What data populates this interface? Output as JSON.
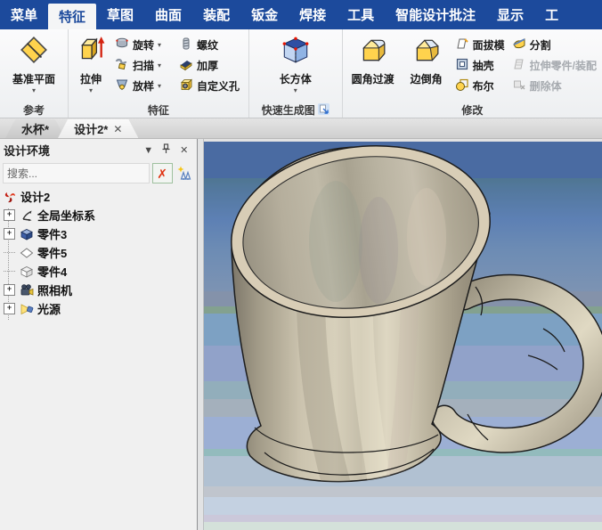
{
  "colors": {
    "menubar_blue": "#1c4a9c",
    "mug_body_tan": "#c5beaa",
    "viewport_sky_top": "#4a6ba2",
    "viewport_sky_bottom": "#d4e1da"
  },
  "menu": {
    "items": [
      {
        "label": "菜单",
        "active": false
      },
      {
        "label": "特征",
        "active": true
      },
      {
        "label": "草图",
        "active": false
      },
      {
        "label": "曲面",
        "active": false
      },
      {
        "label": "装配",
        "active": false
      },
      {
        "label": "钣金",
        "active": false
      },
      {
        "label": "焊接",
        "active": false
      },
      {
        "label": "工具",
        "active": false
      },
      {
        "label": "智能设计批注",
        "active": false
      },
      {
        "label": "显示",
        "active": false
      },
      {
        "label": "工",
        "active": false
      }
    ]
  },
  "ribbon": {
    "groups": [
      {
        "label": "参考"
      },
      {
        "label": "特征"
      },
      {
        "label": "快速生成图"
      },
      {
        "label": "修改"
      }
    ],
    "buttons": {
      "datum_plane": "基准平面",
      "extrude": "拉伸",
      "revolve": "旋转",
      "sweep": "扫描",
      "loft": "放样",
      "thread": "螺纹",
      "thicken": "加厚",
      "custom_hole": "自定义孔",
      "box": "长方体",
      "fillet": "圆角过渡",
      "chamfer": "边倒角",
      "face_draft": "面拔模",
      "shell": "抽壳",
      "boolean": "布尔",
      "split": "分割",
      "stretch_part": "拉伸零件/装配",
      "delete_body": "删除体"
    }
  },
  "document_tabs": [
    {
      "label": "水杯*",
      "active": false
    },
    {
      "label": "设计2*",
      "active": true
    }
  ],
  "panel": {
    "title": "设计环境",
    "search_placeholder": "搜索...",
    "tree": {
      "root": "设计2",
      "items": [
        {
          "label": "全局坐标系",
          "expandable": true
        },
        {
          "label": "零件3",
          "expandable": true
        },
        {
          "label": "零件5",
          "expandable": false
        },
        {
          "label": "零件4",
          "expandable": false
        },
        {
          "label": "照相机",
          "expandable": true
        },
        {
          "label": "光源",
          "expandable": true
        }
      ]
    }
  }
}
